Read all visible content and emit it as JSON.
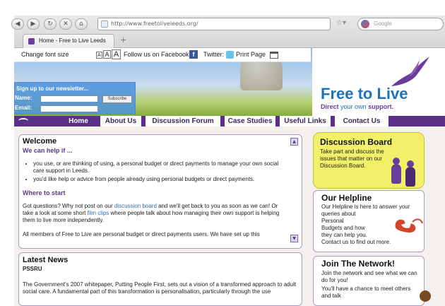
{
  "browser": {
    "url": "http://www.freetoliveleeds.org/",
    "search_placeholder": "Google",
    "tab_title": "Home - Free to Live Leeds",
    "new_tab": "+",
    "icons": [
      "back-icon",
      "forward-icon",
      "reload-icon",
      "stop-icon",
      "home-icon",
      "star-icon"
    ]
  },
  "utility": {
    "font_size_label": "Change font size",
    "font_a_small": "A",
    "font_a_medium": "A",
    "font_a_large": "A",
    "facebook_label": "Follow us on Facebook:",
    "facebook_icon_text": "f",
    "twitter_label": "Twitter:",
    "print_label": "Print Page"
  },
  "newsletter": {
    "title": "Sign up to our newsletter...",
    "name_label": "Name:",
    "email_label": "Email:",
    "subscribe": "Subscribe"
  },
  "logo": {
    "title": "Free to Live",
    "tagline_direct": "Direct",
    "tagline_rest": "your own",
    "tagline_support": "support."
  },
  "nav": [
    "Home",
    "About Us",
    "Discussion Forum",
    "Case Studies",
    "Useful Links",
    "Contact Us"
  ],
  "welcome": {
    "title": "Welcome",
    "subtitle": "We can help if ...",
    "bullet_1": "you use, or are thinking of using, a personal budget or direct payments to manage your own social care support in Leeds.",
    "bullet_2": "you'd like help or advice from people already using personal budgets or direct payments.",
    "where_to_start": "Where to start",
    "p1_before": "Got questions? Why not post on our",
    "p1_link1": "discussion board",
    "p1_middle": "and we'll get back to you as soon as we can! Or take a look at some short",
    "p1_link2": "film clips",
    "p1_after": "where people talk about how managing their own support is helping them to live more independently.",
    "p2": "All members of Free to Live are personal budget or direct payments users. We have set up this"
  },
  "latest_news": {
    "title": "Latest News",
    "subtitle": "PSSRU",
    "text": "The Government's 2007 whitepaper, Putting People First, sets out a vision of a transformed approach to adult social care. A fundamental part of this transformation is personalisation, particularly through the use"
  },
  "discussion_board": {
    "title": "Discussion Board",
    "text": "Take part and discuss the issues that matter on our Discussion Board."
  },
  "helpline": {
    "title": "Our Helpline",
    "line1": "Our Helpline is here to answer your queries about",
    "line2": "Personal",
    "line3": "Budgets and how",
    "line4": "they can help you.",
    "line5": "Contact us to find out more."
  },
  "network": {
    "title": "Join The Network!",
    "line1": "Join the network and see what we can do for you!",
    "line2": "You'll have a chance to meet others and talk"
  },
  "colors": {
    "brand_purple": "#5c2f86",
    "logo_blue": "#1f71b8",
    "bubble_yellow": "#f2f068",
    "phone_red": "#d2452a"
  }
}
